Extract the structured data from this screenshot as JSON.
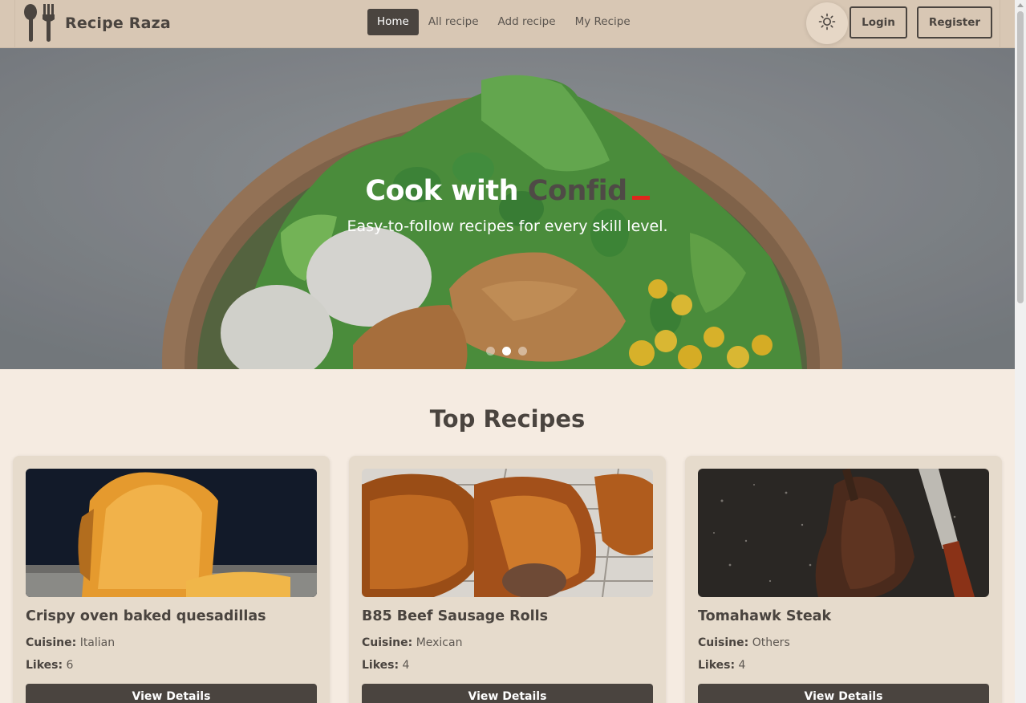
{
  "navbar": {
    "brand": "Recipe Raza",
    "links": [
      {
        "label": "Home",
        "active": true
      },
      {
        "label": "All recipe",
        "active": false
      },
      {
        "label": "Add recipe",
        "active": false
      },
      {
        "label": "My Recipe",
        "active": false
      }
    ],
    "theme_icon": "sun-icon",
    "login_label": "Login",
    "register_label": "Register"
  },
  "hero": {
    "title_static": "Cook with",
    "title_typed": "Confid",
    "subtitle": "Easy-to-follow recipes for every skill level.",
    "slide_count": 3,
    "active_slide": 2
  },
  "section": {
    "title": "Top Recipes"
  },
  "recipes": [
    {
      "title": "Crispy oven baked quesadillas",
      "cuisine_label": "Cuisine:",
      "cuisine": "Italian",
      "likes_label": "Likes:",
      "likes": "6",
      "button": "View Details"
    },
    {
      "title": "B85 Beef Sausage Rolls",
      "cuisine_label": "Cuisine:",
      "cuisine": "Mexican",
      "likes_label": "Likes:",
      "likes": "4",
      "button": "View Details"
    },
    {
      "title": "Tomahawk Steak",
      "cuisine_label": "Cuisine:",
      "cuisine": "Others",
      "likes_label": "Likes:",
      "likes": "4",
      "button": "View Details"
    }
  ],
  "colors": {
    "navbar_bg": "#d8c7b4",
    "page_bg": "#f5ebe1",
    "card_bg": "#e6dbcc",
    "dark": "#4a443f",
    "cursor_accent": "#e1261c"
  }
}
